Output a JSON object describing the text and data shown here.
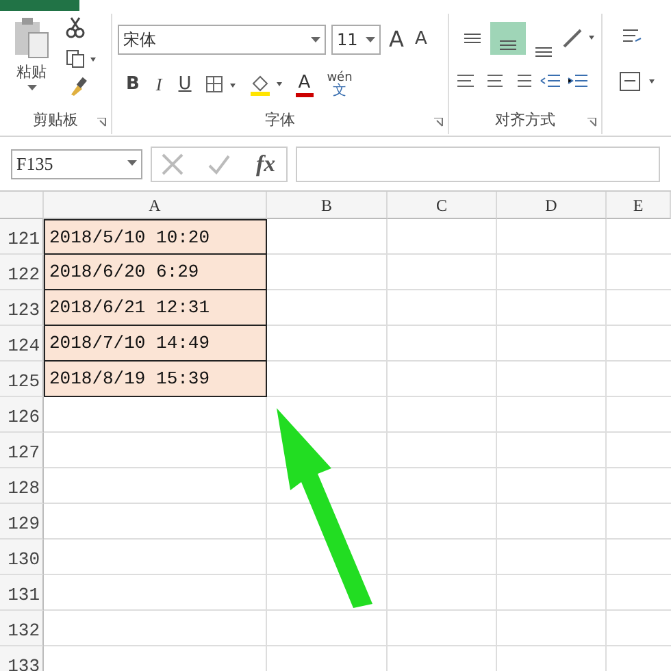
{
  "ribbon": {
    "clipboard": {
      "paste": "粘贴",
      "label": "剪贴板"
    },
    "font": {
      "name": "宋体",
      "size": "11",
      "bold": "B",
      "italic": "I",
      "underline": "U",
      "grow": "A",
      "shrink": "A",
      "font_color": "A",
      "phonetic_top": "wén",
      "phonetic_bottom": "文",
      "label": "字体"
    },
    "alignment": {
      "vertical": [
        {
          "kind": "top",
          "selected": false
        },
        {
          "kind": "middle",
          "selected": true
        },
        {
          "kind": "bottom",
          "selected": false
        }
      ],
      "label": "对齐方式"
    }
  },
  "formula_bar": {
    "name_box": "F135",
    "fx": "fx"
  },
  "columns": [
    "A",
    "B",
    "C",
    "D",
    "E"
  ],
  "rows": [
    {
      "number": "121",
      "a": "2018/5/10 10:20",
      "filled": true
    },
    {
      "number": "122",
      "a": "2018/6/20 6:29",
      "filled": true
    },
    {
      "number": "123",
      "a": "2018/6/21 12:31",
      "filled": true
    },
    {
      "number": "124",
      "a": "2018/7/10 14:49",
      "filled": true
    },
    {
      "number": "125",
      "a": "2018/8/19 15:39",
      "filled": true
    },
    {
      "number": "126",
      "filled": false
    },
    {
      "number": "127",
      "filled": false
    },
    {
      "number": "128",
      "filled": false
    },
    {
      "number": "129",
      "filled": false
    },
    {
      "number": "130",
      "filled": false
    },
    {
      "number": "131",
      "filled": false
    },
    {
      "number": "132",
      "filled": false
    },
    {
      "number": "133",
      "filled": false
    }
  ]
}
